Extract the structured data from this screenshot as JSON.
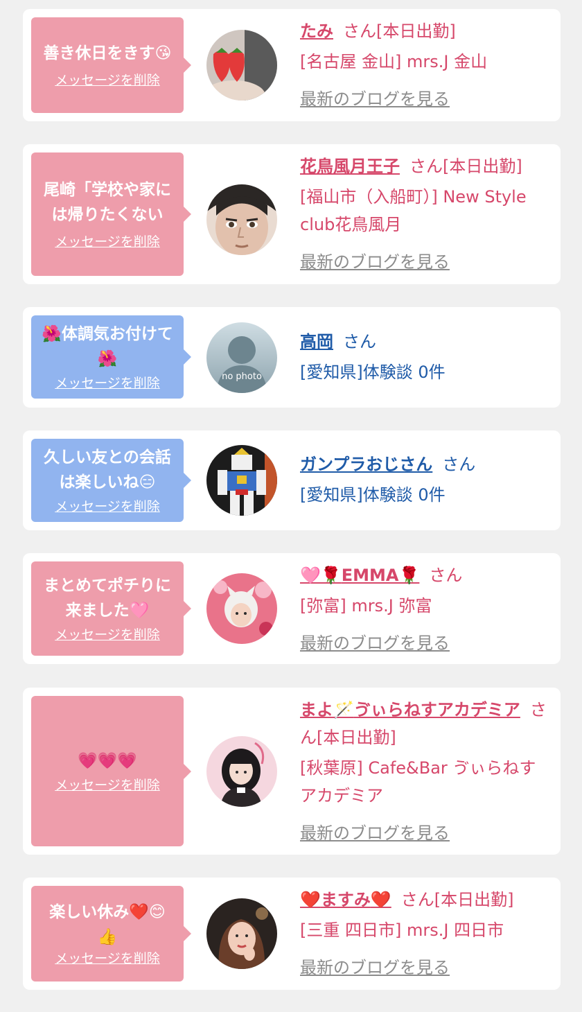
{
  "delete_label": "メッセージを削除",
  "san_label": "さん",
  "blog_label": "最新のブログを見る",
  "colors": {
    "background": "#f0f0f0",
    "pink_bubble": "#ee9dab",
    "blue_bubble": "#91b4ef",
    "pink_text": "#d6476a",
    "blue_text": "#1f5ba8",
    "blog_text": "#8c8c8c"
  },
  "items": [
    {
      "message": "善き休日をきす",
      "message_emoji": "😘",
      "name": "たみ",
      "status": "[本日出勤]",
      "shop": "[名古屋 金山] mrs.J 金山",
      "avatar_icon": "strawberry-photo"
    },
    {
      "message": "尾崎「学校や家には帰りたくない",
      "message_emoji": "",
      "name": "花鳥風月王子",
      "status": "[本日出勤]",
      "shop": "[福山市（入船町）] New Style club花鳥風月",
      "avatar_icon": "face-photo"
    },
    {
      "message_emoji_before": "🌺",
      "message": "体調気お付けて",
      "message_emoji": "🌺",
      "name": "高岡",
      "status": "",
      "shop": "[愛知県]体験談 0件",
      "avatar_icon": "no-photo",
      "avatar_text": "no photo"
    },
    {
      "message": "久しい友との会話は楽しいね",
      "message_emoji": "😑",
      "name": "ガンプラおじさん",
      "status": "",
      "shop": "[愛知県]体験談 0件",
      "avatar_icon": "robot-photo"
    },
    {
      "message": "まとめてポチりに来ました",
      "message_emoji": "🩷",
      "name_prefix": "🩷🌹",
      "name": "EMMA",
      "name_suffix": "🌹",
      "status": "",
      "shop": "[弥富] mrs.J 弥富",
      "avatar_icon": "person-photo"
    },
    {
      "message": "",
      "message_emoji": "💗💗💗",
      "name": "まよ",
      "name_emoji": "🪄",
      "name_rest": "ゔぃらねすアカデミア",
      "status": "[本日出勤]",
      "shop": "[秋葉原] Cafe&Bar ゔぃらねすアカデミア",
      "avatar_icon": "person-photo"
    },
    {
      "message": "楽しい休み",
      "message_emoji": "❤️😊",
      "message_emoji_2": "👍",
      "name_prefix": "❤️",
      "name": "ますみ",
      "name_suffix": "❤️",
      "status": "[本日出勤]",
      "shop": "[三重 四日市] mrs.J 四日市",
      "avatar_icon": "person-photo"
    }
  ]
}
